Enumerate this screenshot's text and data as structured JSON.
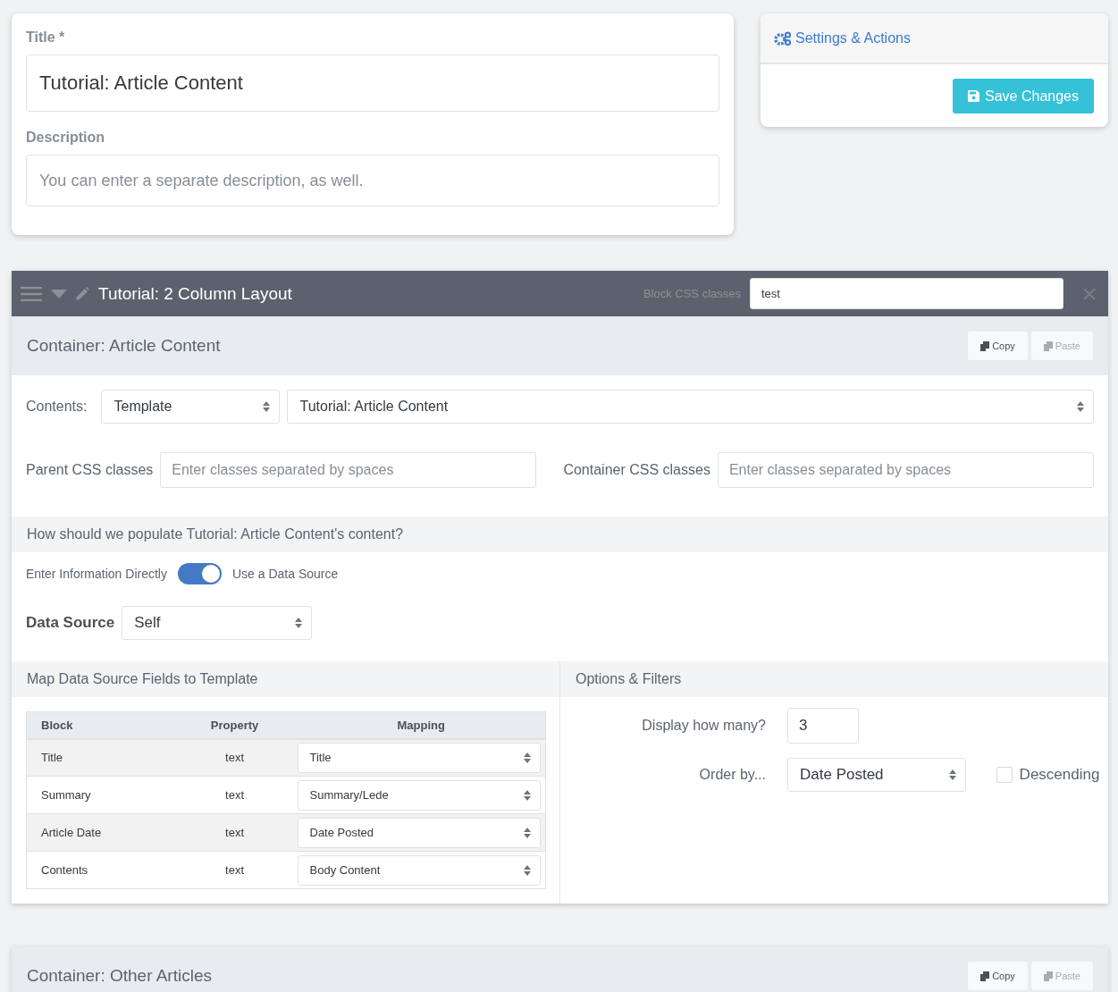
{
  "title_field": {
    "label": "Title *",
    "value": "Tutorial: Article Content"
  },
  "description_field": {
    "label": "Description",
    "placeholder": "You can enter a separate description, as well."
  },
  "settings_panel": {
    "title": "Settings & Actions",
    "save_button": "Save Changes"
  },
  "block": {
    "title": "Tutorial: 2 Column Layout",
    "css_label": "Block CSS classes",
    "css_value": "test"
  },
  "containers": [
    {
      "title": "Container: Article Content",
      "buttons": [
        {
          "label": "Copy",
          "disabled": false
        },
        {
          "label": "Paste",
          "disabled": true
        }
      ],
      "contents_label": "Contents:",
      "contents_type": "Template",
      "contents_template": "Tutorial: Article Content",
      "parent_css": {
        "label": "Parent CSS classes",
        "placeholder": "Enter classes separated by spaces"
      },
      "container_css": {
        "label": "Container CSS classes",
        "placeholder": "Enter classes separated by spaces"
      },
      "populate_heading": "How should we populate Tutorial: Article Content's content?",
      "toggle": {
        "off_label": "Enter Information Directly",
        "on_label": "Use a Data Source",
        "on": true
      },
      "data_source": {
        "label": "Data Source",
        "value": "Self"
      },
      "mapping": {
        "heading": "Map Data Source Fields to Template",
        "columns": [
          "Block",
          "Property",
          "Mapping"
        ],
        "rows": [
          {
            "block": "Title",
            "property": "text",
            "mapping": "Title"
          },
          {
            "block": "Summary",
            "property": "text",
            "mapping": "Summary/Lede"
          },
          {
            "block": "Article Date",
            "property": "text",
            "mapping": "Date Posted"
          },
          {
            "block": "Contents",
            "property": "text",
            "mapping": "Body Content"
          }
        ]
      },
      "options": {
        "heading": "Options & Filters",
        "count_label": "Display how many?",
        "count_value": "3",
        "order_label": "Order by...",
        "order_value": "Date Posted",
        "descending_label": "Descending",
        "descending": false
      }
    },
    {
      "title": "Container: Other Articles",
      "buttons": [
        {
          "label": "Copy",
          "disabled": false
        },
        {
          "label": "Paste",
          "disabled": true
        }
      ]
    }
  ]
}
